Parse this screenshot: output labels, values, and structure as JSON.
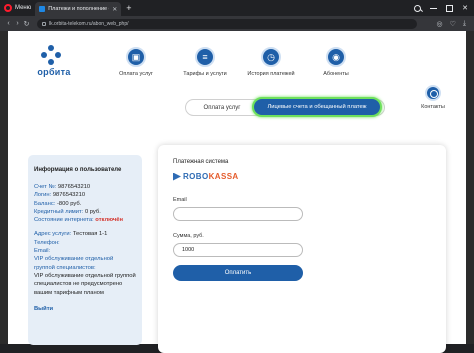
{
  "browser": {
    "menu_label": "Меню",
    "tab_title": "Платежи и пополнение сч...",
    "url": "lk.orbita-telekom.ru/abon_web_php/"
  },
  "site": {
    "logo_text": "орбита",
    "nav": [
      {
        "label": "Оплата услуг",
        "icon": "wallet-icon"
      },
      {
        "label": "Тарифы и услуги",
        "icon": "list-icon"
      },
      {
        "label": "История платежей",
        "icon": "clock-icon"
      },
      {
        "label": "Абоненты",
        "icon": "globe-icon"
      }
    ],
    "contacts_label": "Контакты"
  },
  "tabs": {
    "pay": "Оплата услуг",
    "accounts": "Лицевые счета и обещанный платеж"
  },
  "user_info": {
    "heading": "Информация о пользователе",
    "account_label": "Счет №:",
    "account": "9876543210",
    "login_label": "Логин:",
    "login": "9876543210",
    "balance_label": "Баланс:",
    "balance": "-800 руб.",
    "credit_label": "Кредитный лимит:",
    "credit": "0 руб.",
    "internet_label": "Состояние интернета:",
    "internet_status": "отключён",
    "address_label": "Адрес услуги:",
    "address": "Тестовая 1-1",
    "phone_label": "Телефон:",
    "email_label": "Email:",
    "vip_lines": [
      "VIP обслуживание отдельной",
      "группой специалистов:",
      "VIP обслуживание отдельной группой",
      "специалистов не предусмотрено",
      "вашим тарифным планом"
    ],
    "exit": "Выйти"
  },
  "payment": {
    "heading": "Платежная система",
    "provider_a": "ROBO",
    "provider_b": "KASSA",
    "email_label": "Email",
    "email_value": "",
    "amount_label": "Сумма, руб.",
    "amount_value": "1000",
    "pay_button": "Оплатить"
  },
  "colors": {
    "brand": "#1f5fa8",
    "highlight": "#6ee05c",
    "status_off": "#d4322a"
  }
}
